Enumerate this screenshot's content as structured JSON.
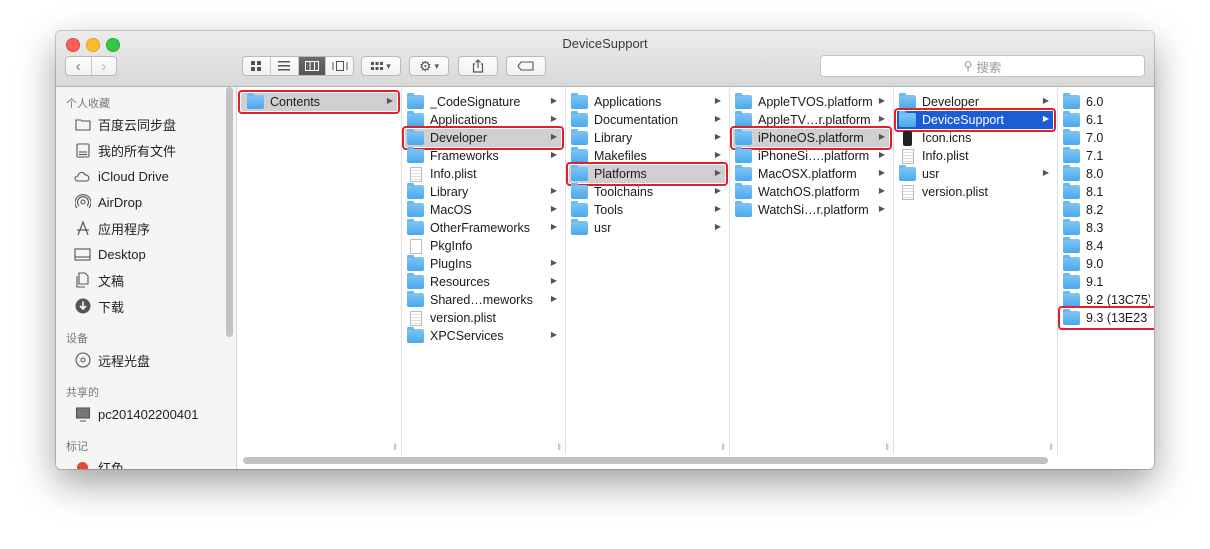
{
  "window": {
    "title": "DeviceSupport"
  },
  "toolbar": {
    "back": "‹",
    "forward": "›",
    "views": [
      "icon-view",
      "list-view",
      "column-view",
      "coverflow-view"
    ],
    "arrange_label": "▾",
    "action_label": "▾",
    "search_placeholder": "搜索"
  },
  "sidebar": {
    "favorites_header": "个人收藏",
    "favorites": [
      {
        "label": "百度云同步盘",
        "icon": "folder-icon"
      },
      {
        "label": "我的所有文件",
        "icon": "all-files-icon"
      },
      {
        "label": "iCloud Drive",
        "icon": "cloud-icon"
      },
      {
        "label": "AirDrop",
        "icon": "airdrop-icon"
      },
      {
        "label": "应用程序",
        "icon": "applications-icon"
      },
      {
        "label": "Desktop",
        "icon": "desktop-icon"
      },
      {
        "label": "文稿",
        "icon": "documents-icon"
      },
      {
        "label": "下载",
        "icon": "downloads-icon"
      }
    ],
    "devices_header": "设备",
    "devices": [
      {
        "label": "远程光盘",
        "icon": "disc-icon"
      }
    ],
    "shared_header": "共享的",
    "shared": [
      {
        "label": "pc201402200401",
        "icon": "computer-icon"
      }
    ],
    "tags_header": "标记",
    "tags": [
      {
        "label": "红色",
        "color": "#e8453c"
      }
    ]
  },
  "columns": [
    {
      "items": [
        {
          "name": "Contents",
          "kind": "folder",
          "arrow": true,
          "state": "path"
        }
      ]
    },
    {
      "items": [
        {
          "name": "_CodeSignature",
          "kind": "folder",
          "arrow": true
        },
        {
          "name": "Applications",
          "kind": "folder",
          "arrow": true
        },
        {
          "name": "Developer",
          "kind": "folder",
          "arrow": true,
          "state": "path"
        },
        {
          "name": "Frameworks",
          "kind": "folder",
          "arrow": true
        },
        {
          "name": "Info.plist",
          "kind": "doc",
          "arrow": false
        },
        {
          "name": "Library",
          "kind": "folder",
          "arrow": true
        },
        {
          "name": "MacOS",
          "kind": "folder",
          "arrow": true
        },
        {
          "name": "OtherFrameworks",
          "kind": "folder",
          "arrow": true
        },
        {
          "name": "PkgInfo",
          "kind": "file",
          "arrow": false
        },
        {
          "name": "PlugIns",
          "kind": "folder",
          "arrow": true
        },
        {
          "name": "Resources",
          "kind": "folder",
          "arrow": true
        },
        {
          "name": "Shared…meworks",
          "kind": "folder",
          "arrow": true
        },
        {
          "name": "version.plist",
          "kind": "doc",
          "arrow": false
        },
        {
          "name": "XPCServices",
          "kind": "folder",
          "arrow": true
        }
      ]
    },
    {
      "items": [
        {
          "name": "Applications",
          "kind": "folder",
          "arrow": true
        },
        {
          "name": "Documentation",
          "kind": "folder",
          "arrow": true
        },
        {
          "name": "Library",
          "kind": "folder",
          "arrow": true
        },
        {
          "name": "Makefiles",
          "kind": "folder",
          "arrow": true
        },
        {
          "name": "Platforms",
          "kind": "folder",
          "arrow": true,
          "state": "path"
        },
        {
          "name": "Toolchains",
          "kind": "folder",
          "arrow": true
        },
        {
          "name": "Tools",
          "kind": "folder",
          "arrow": true
        },
        {
          "name": "usr",
          "kind": "folder",
          "arrow": true
        }
      ]
    },
    {
      "items": [
        {
          "name": "AppleTVOS.platform",
          "kind": "folder",
          "arrow": true
        },
        {
          "name": "AppleTV…r.platform",
          "kind": "folder",
          "arrow": true
        },
        {
          "name": "iPhoneOS.platform",
          "kind": "folder",
          "arrow": true,
          "state": "path"
        },
        {
          "name": "iPhoneSi….platform",
          "kind": "folder",
          "arrow": true
        },
        {
          "name": "MacOSX.platform",
          "kind": "folder",
          "arrow": true
        },
        {
          "name": "WatchOS.platform",
          "kind": "folder",
          "arrow": true
        },
        {
          "name": "WatchSi…r.platform",
          "kind": "folder",
          "arrow": true
        }
      ]
    },
    {
      "items": [
        {
          "name": "Developer",
          "kind": "folder",
          "arrow": true
        },
        {
          "name": "DeviceSupport",
          "kind": "folder",
          "arrow": true,
          "state": "active"
        },
        {
          "name": "Icon.icns",
          "kind": "icns",
          "arrow": false
        },
        {
          "name": "Info.plist",
          "kind": "doc",
          "arrow": false
        },
        {
          "name": "usr",
          "kind": "folder",
          "arrow": true
        },
        {
          "name": "version.plist",
          "kind": "doc",
          "arrow": false
        }
      ]
    },
    {
      "items": [
        {
          "name": "6.0",
          "kind": "folder",
          "arrow": false
        },
        {
          "name": "6.1",
          "kind": "folder",
          "arrow": false
        },
        {
          "name": "7.0",
          "kind": "folder",
          "arrow": false
        },
        {
          "name": "7.1",
          "kind": "folder",
          "arrow": false
        },
        {
          "name": "8.0",
          "kind": "folder",
          "arrow": false
        },
        {
          "name": "8.1",
          "kind": "folder",
          "arrow": false
        },
        {
          "name": "8.2",
          "kind": "folder",
          "arrow": false
        },
        {
          "name": "8.3",
          "kind": "folder",
          "arrow": false
        },
        {
          "name": "8.4",
          "kind": "folder",
          "arrow": false
        },
        {
          "name": "9.0",
          "kind": "folder",
          "arrow": false
        },
        {
          "name": "9.1",
          "kind": "folder",
          "arrow": false
        },
        {
          "name": "9.2 (13C75)",
          "kind": "folder",
          "arrow": false
        },
        {
          "name": "9.3 (13E23",
          "kind": "folder",
          "arrow": false
        }
      ]
    }
  ],
  "highlight_color": "#e2202b"
}
